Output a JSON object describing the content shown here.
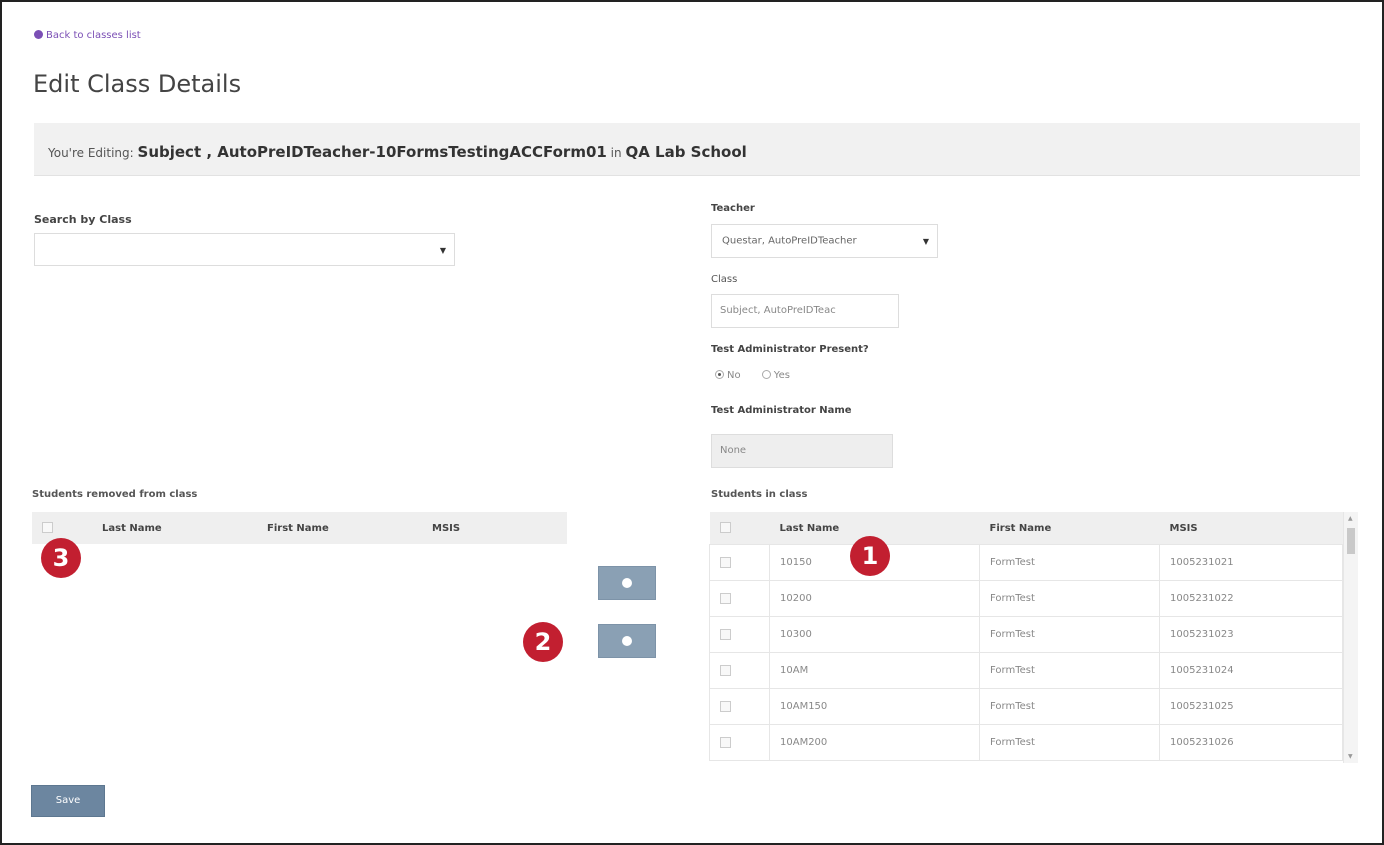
{
  "back_link": "Back to classes list",
  "page_title": "Edit Class Details",
  "editing": {
    "prefix": "You're Editing:",
    "class_name": "Subject , AutoPreIDTeacher-10FormsTestingACCForm01",
    "connector": "in",
    "school": "QA Lab School"
  },
  "search": {
    "label": "Search by Class",
    "value": ""
  },
  "teacher": {
    "label": "Teacher",
    "value": "Questar, AutoPreIDTeacher"
  },
  "class_field": {
    "label": "Class",
    "value": "Subject, AutoPreIDTeac"
  },
  "ta_present": {
    "label": "Test Administrator Present?",
    "options": [
      "No",
      "Yes"
    ],
    "selected": "No"
  },
  "ta_name": {
    "label": "Test Administrator Name",
    "value": "None"
  },
  "removed_table": {
    "label": "Students removed from class",
    "headers": [
      "Last Name",
      "First Name",
      "MSIS"
    ],
    "rows": []
  },
  "class_table": {
    "label": "Students in class",
    "headers": [
      "Last Name",
      "First Name",
      "MSIS"
    ],
    "rows": [
      [
        "10150",
        "FormTest",
        "1005231021"
      ],
      [
        "10200",
        "FormTest",
        "1005231022"
      ],
      [
        "10300",
        "FormTest",
        "1005231023"
      ],
      [
        "10AM",
        "FormTest",
        "1005231024"
      ],
      [
        "10AM150",
        "FormTest",
        "1005231025"
      ],
      [
        "10AM200",
        "FormTest",
        "1005231026"
      ]
    ]
  },
  "save_label": "Save",
  "markers": [
    "1",
    "2",
    "3"
  ],
  "colors": {
    "marker": "#c21f30",
    "button": "#8aa0b4",
    "link": "#7b4fb5"
  }
}
